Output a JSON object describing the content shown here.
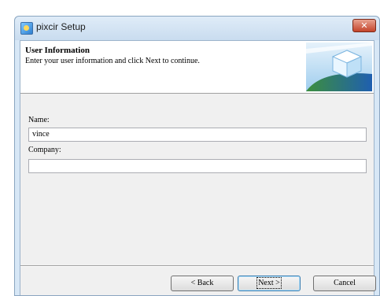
{
  "window": {
    "title": "pixcir Setup",
    "close_glyph": "✕"
  },
  "banner": {
    "title": "User Information",
    "subtitle": "Enter your user information and click Next to continue.",
    "graphic_icon": "installer-cube-graphic"
  },
  "form": {
    "name_label": "Name:",
    "name_value": "vince",
    "company_label": "Company:",
    "company_value": ""
  },
  "buttons": {
    "back_label": "< Back",
    "next_label": "Next >",
    "cancel_label": "Cancel"
  },
  "colors": {
    "title_bar": "#d7e7f6",
    "close_button": "#c4442b",
    "dialog_face": "#f0f0f0"
  }
}
